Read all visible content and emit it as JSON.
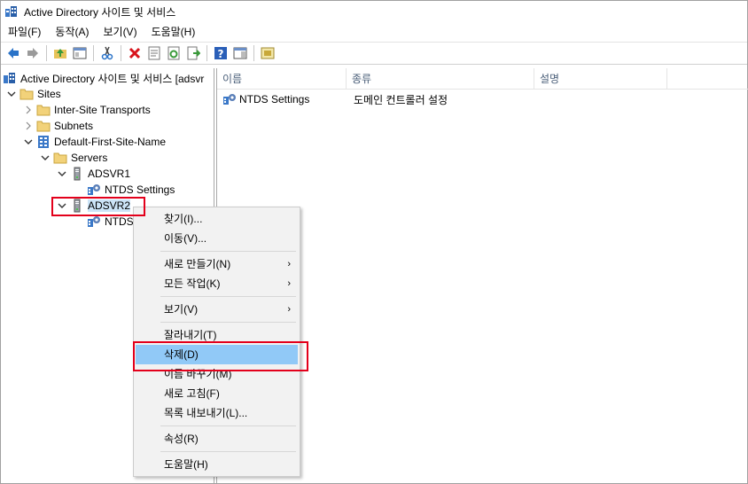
{
  "window": {
    "title": "Active Directory 사이트 및 서비스"
  },
  "menubar": {
    "items": [
      "파일(F)",
      "동작(A)",
      "보기(V)",
      "도움말(H)"
    ]
  },
  "toolbar": {
    "buttons": [
      "back-icon",
      "forward-icon",
      "up-folder-icon",
      "show-hide-tree-icon",
      "cut-icon",
      "delete-icon",
      "properties-icon",
      "refresh-icon",
      "export-list-icon",
      "help-icon",
      "action-pane-icon",
      "new-site-icon"
    ]
  },
  "tree": {
    "root": "Active Directory 사이트 및 서비스 [adsvr",
    "sites": "Sites",
    "inter_site": "Inter-Site Transports",
    "subnets": "Subnets",
    "default_site": "Default-First-Site-Name",
    "servers": "Servers",
    "adsvr1": "ADSVR1",
    "adsvr1_ntds": "NTDS Settings",
    "adsvr2": "ADSVR2",
    "adsvr2_ntds": "NTDS Settings"
  },
  "list": {
    "columns": [
      "이름",
      "종류",
      "설명"
    ],
    "rows": [
      {
        "name": "NTDS Settings",
        "type": "도메인 컨트롤러 설정",
        "description": ""
      }
    ]
  },
  "context_menu": {
    "find": "찾기(I)...",
    "move": "이동(V)...",
    "new": "새로 만들기(N)",
    "all_tasks": "모든 작업(K)",
    "view": "보기(V)",
    "cut": "잘라내기(T)",
    "delete": "삭제(D)",
    "rename": "이름 바꾸기(M)",
    "refresh": "새로 고침(F)",
    "export": "목록 내보내기(L)...",
    "properties": "속성(R)",
    "help": "도움말(H)",
    "submenu_arrow": "›"
  },
  "colors": {
    "highlight": "#91c9f7",
    "annotation_red": "#e3001b",
    "menu_bg": "#f2f2f2"
  }
}
